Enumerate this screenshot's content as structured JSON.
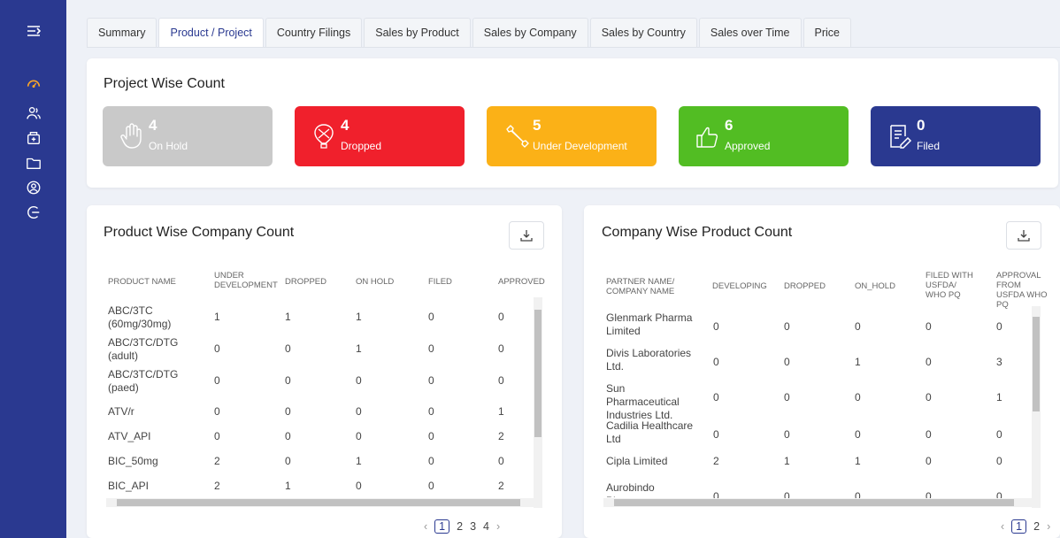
{
  "sidebar": {
    "icons": [
      "menu-icon",
      "dashboard-icon",
      "users-icon",
      "package-icon",
      "folder-icon",
      "account-icon",
      "logout-icon"
    ]
  },
  "tabs": [
    "Summary",
    "Product / Project",
    "Country Filings",
    "Sales by Product",
    "Sales by Company",
    "Sales by Country",
    "Sales over Time",
    "Price"
  ],
  "project": {
    "title": "Project Wise Count",
    "stats": [
      {
        "value": "4",
        "label": "On Hold",
        "color": "#c9c9c9"
      },
      {
        "value": "4",
        "label": "Dropped",
        "color": "#f0202c"
      },
      {
        "value": "5",
        "label": "Under Development",
        "color": "#fbb117"
      },
      {
        "value": "6",
        "label": "Approved",
        "color": "#52bd23"
      },
      {
        "value": "0",
        "label": "Filed",
        "color": "#2a3990"
      }
    ]
  },
  "product_table": {
    "title": "Product Wise Company Count",
    "headers": [
      "PRODUCT NAME",
      "UNDER DEVELOPMENT",
      "DROPPED",
      "ON HOLD",
      "FILED",
      "APPROVED"
    ],
    "rows": [
      [
        "ABC/3TC (60mg/30mg)",
        "1",
        "1",
        "1",
        "0",
        "0"
      ],
      [
        "ABC/3TC/DTG (adult)",
        "0",
        "0",
        "1",
        "0",
        "0"
      ],
      [
        "ABC/3TC/DTG (paed)",
        "0",
        "0",
        "0",
        "0",
        "0"
      ],
      [
        "ATV/r",
        "0",
        "0",
        "0",
        "0",
        "1"
      ],
      [
        "ATV_API",
        "0",
        "0",
        "0",
        "0",
        "2"
      ],
      [
        "BIC_50mg",
        "2",
        "0",
        "1",
        "0",
        "0"
      ],
      [
        "BIC_API",
        "2",
        "1",
        "0",
        "0",
        "2"
      ]
    ],
    "pages": [
      "1",
      "2",
      "3",
      "4"
    ]
  },
  "company_table": {
    "title": "Company Wise Product Count",
    "headers": [
      "PARTNER NAME/ COMPANY NAME",
      "DEVELOPING",
      "DROPPED",
      "ON_HOLD",
      "FILED WITH USFDA/ WHO PQ",
      "APPROVAL FROM USFDA WHO PQ"
    ],
    "rows": [
      [
        "Glenmark Pharma Limited",
        "0",
        "0",
        "0",
        "0",
        "0"
      ],
      [
        "Divis Laboratories Ltd.",
        "0",
        "0",
        "1",
        "0",
        "3"
      ],
      [
        "Sun Pharmaceutical Industries Ltd.",
        "0",
        "0",
        "0",
        "0",
        "1"
      ],
      [
        "Cadilia Healthcare Ltd",
        "0",
        "0",
        "0",
        "0",
        "0"
      ],
      [
        "Cipla Limited",
        "2",
        "1",
        "1",
        "0",
        "0"
      ],
      [
        "Aurobindo Pharma",
        "0",
        "0",
        "0",
        "0",
        "0"
      ]
    ],
    "pages": [
      "1",
      "2"
    ]
  }
}
